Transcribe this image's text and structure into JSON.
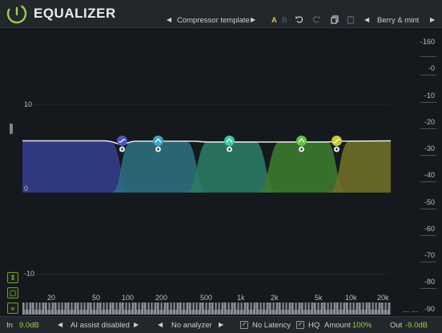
{
  "header": {
    "title": "EQUALIZER",
    "preset_name": "Compressor template",
    "ab_a": "A",
    "ab_b": "B",
    "theme_name": "Berry & mint",
    "prev_arrow": "◀",
    "next_arrow": "▶"
  },
  "plot": {
    "y_labels": [
      "10",
      "0",
      "-10"
    ],
    "x_labels": [
      "20",
      "50",
      "100",
      "200",
      "500",
      "1k",
      "2k",
      "5k",
      "10k",
      "20k"
    ]
  },
  "scale": {
    "labels": [
      "-160",
      "-0",
      "-10",
      "-20",
      "-30",
      "-40",
      "-50",
      "-60",
      "-70",
      "-80",
      "-90"
    ]
  },
  "bands": [
    {
      "name": "band-1",
      "color": "#4a55c0",
      "fill": "#333d8c",
      "type": "low-shelf",
      "freq_hz": 90
    },
    {
      "name": "band-2",
      "color": "#3ba5c6",
      "fill": "#2d6e80",
      "type": "bell",
      "freq_hz": 180
    },
    {
      "name": "band-3",
      "color": "#3cc9a6",
      "fill": "#2a7a66",
      "type": "bell",
      "freq_hz": 900
    },
    {
      "name": "band-4",
      "color": "#5ec43c",
      "fill": "#3b7a2c",
      "type": "bell",
      "freq_hz": 4000
    },
    {
      "name": "band-5",
      "color": "#c9c734",
      "fill": "#6e6e2a",
      "type": "high-shelf",
      "freq_hz": 8000
    }
  ],
  "footer": {
    "in_label": "In",
    "in_value": "9.0dB",
    "ai_assist": "AI assist disabled",
    "analyzer": "No analyzer",
    "no_latency": "No Latency",
    "hq": "HQ",
    "amount_label": "Amount",
    "amount_value": "100%",
    "out_label": "Out",
    "out_value": "-9.0dB",
    "left_arrow": "◀",
    "right_arrow": "▶",
    "check": "✓"
  },
  "colors": {
    "accent": "#9ccf4c",
    "preset_a": "#d8c44a"
  }
}
